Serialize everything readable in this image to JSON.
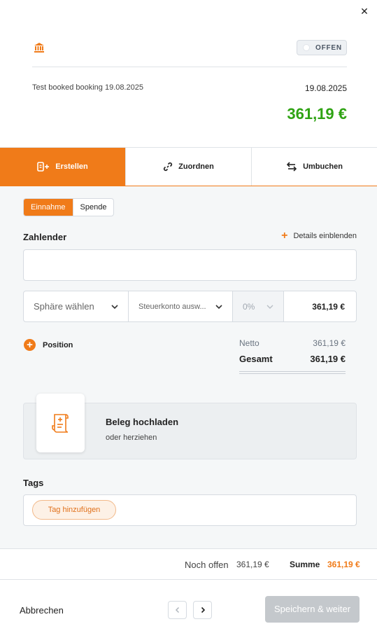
{
  "header": {
    "close_icon": "close-icon",
    "bank_icon": "bank-icon",
    "status": "OFFEN",
    "description": "Test booked booking 19.08.2025",
    "date": "19.08.2025",
    "amount": "361,19 €",
    "amount_color": "#2fa313"
  },
  "tabs": [
    {
      "label": "Erstellen",
      "icon": "create-document-icon",
      "active": true
    },
    {
      "label": "Zuordnen",
      "icon": "link-icon",
      "active": false
    },
    {
      "label": "Umbuchen",
      "icon": "swap-arrows-icon",
      "active": false
    }
  ],
  "type_toggle": {
    "options": [
      "Einnahme",
      "Spende"
    ],
    "selected": "Einnahme"
  },
  "payer": {
    "label": "Zahlender",
    "details_link": "Details einblenden",
    "value": "",
    "placeholder": ""
  },
  "line_item": {
    "sphere_placeholder": "Sphäre wählen",
    "account_placeholder": "Steuerkonto ausw...",
    "tax_rate": "0%",
    "amount": "361,19 €"
  },
  "position_label": "Position",
  "totals": {
    "netto_label": "Netto",
    "netto_value": "361,19 €",
    "gesamt_label": "Gesamt",
    "gesamt_value": "361,19 €"
  },
  "upload": {
    "title": "Beleg hochladen",
    "subtitle": "oder herziehen",
    "icon": "receipt-upload-icon"
  },
  "tags": {
    "label": "Tags",
    "add_label": "Tag hinzufügen"
  },
  "summary": {
    "open_label": "Noch offen",
    "open_value": "361,19 €",
    "total_label": "Summe",
    "total_value": "361,19 €"
  },
  "footer": {
    "cancel_label": "Abbrechen",
    "save_label": "Speichern & weiter",
    "save_enabled": false
  },
  "colors": {
    "accent": "#f07b19",
    "positive": "#2fa313",
    "disabled": "#c4c8cc"
  }
}
